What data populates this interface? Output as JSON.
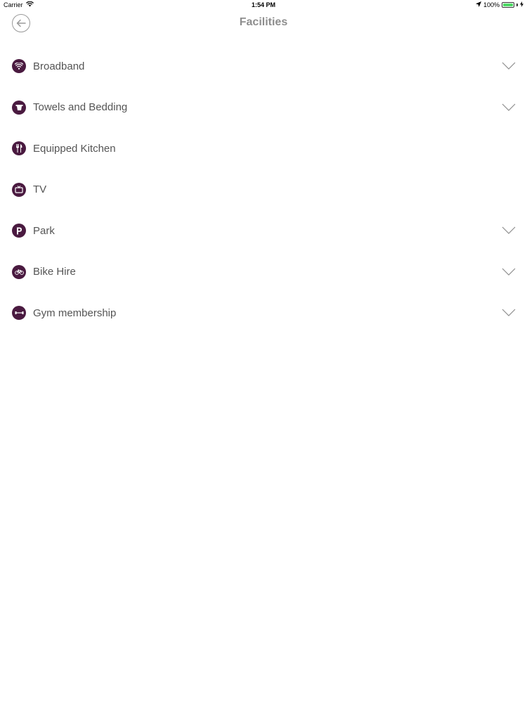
{
  "status_bar": {
    "carrier": "Carrier",
    "time": "1:54 PM",
    "battery": "100%",
    "battery_level": 1.0
  },
  "header": {
    "title": "Facilities",
    "back_icon": "arrow-left-circle-icon"
  },
  "colors": {
    "icon_background": "#4a1a40",
    "label_text": "#555555",
    "title_text": "#8e8e8e",
    "battery_fill": "#4cd964"
  },
  "facilities": [
    {
      "label": "Broadband",
      "icon": "wifi-icon",
      "expandable": true
    },
    {
      "label": "Towels and Bedding",
      "icon": "bucket-icon",
      "expandable": true
    },
    {
      "label": "Equipped Kitchen",
      "icon": "cutlery-icon",
      "expandable": false
    },
    {
      "label": "TV",
      "icon": "tv-icon",
      "expandable": false
    },
    {
      "label": "Park",
      "icon": "parking-icon",
      "expandable": true
    },
    {
      "label": "Bike Hire",
      "icon": "bicycle-icon",
      "expandable": true
    },
    {
      "label": "Gym membership",
      "icon": "dumbbell-icon",
      "expandable": true
    }
  ]
}
